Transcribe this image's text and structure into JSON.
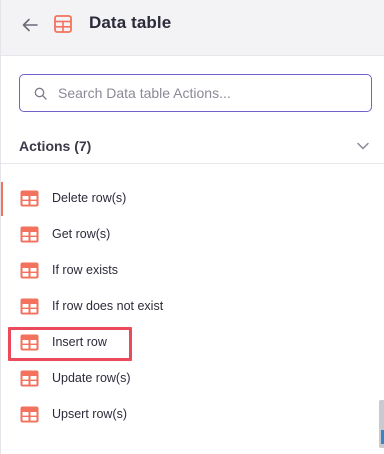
{
  "header": {
    "back_icon": "arrow-left-icon",
    "app_icon": "data-table-icon",
    "title": "Data table"
  },
  "search": {
    "placeholder": "Search Data table Actions...",
    "value": ""
  },
  "section": {
    "title": "Actions (7)",
    "expanded": true
  },
  "actions": [
    {
      "label": "Delete row(s)",
      "icon": "data-table-icon"
    },
    {
      "label": "Get row(s)",
      "icon": "data-table-icon"
    },
    {
      "label": "If row exists",
      "icon": "data-table-icon"
    },
    {
      "label": "If row does not exist",
      "icon": "data-table-icon"
    },
    {
      "label": "Insert row",
      "icon": "data-table-icon"
    },
    {
      "label": "Update row(s)",
      "icon": "data-table-icon"
    },
    {
      "label": "Upsert row(s)",
      "icon": "data-table-icon"
    }
  ],
  "colors": {
    "accent": "#6f63c9",
    "icon": "#f2725e",
    "highlight": "#ea4a5a"
  }
}
